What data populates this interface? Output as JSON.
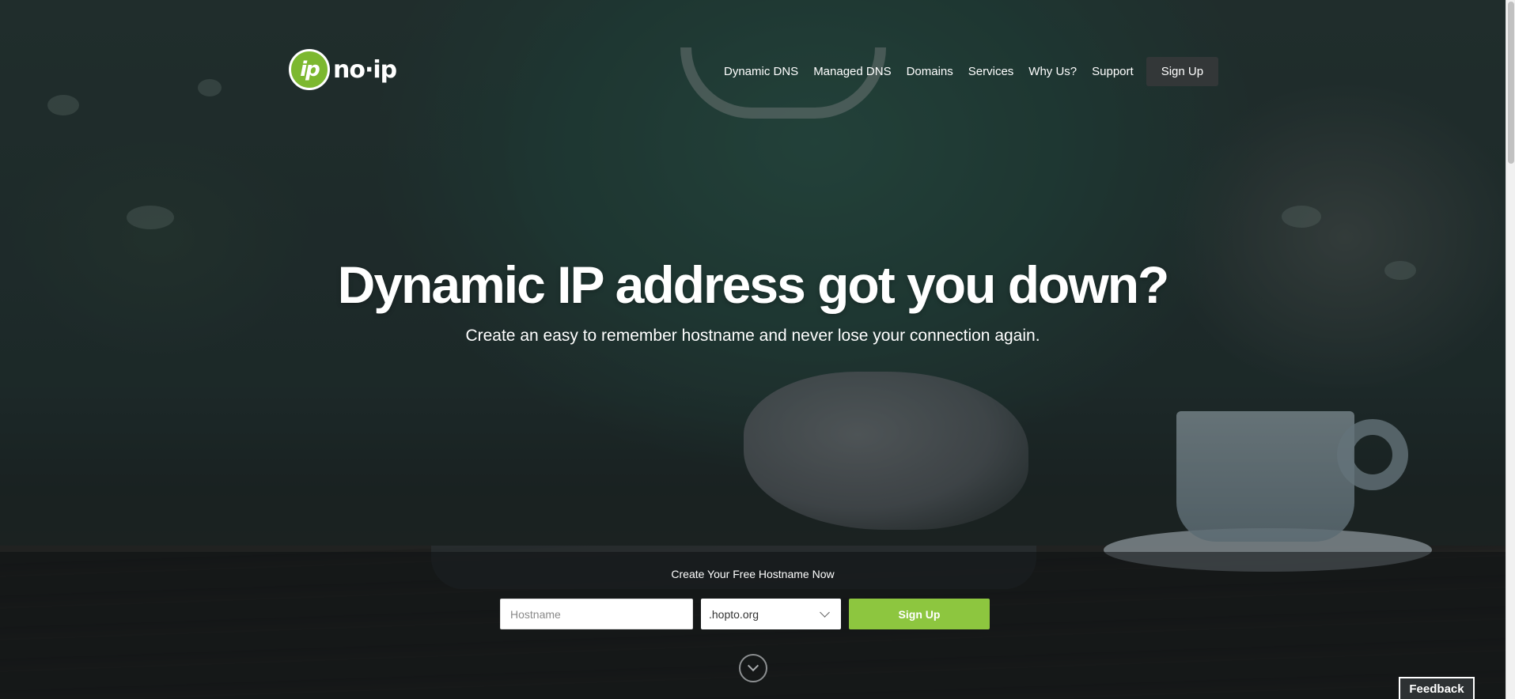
{
  "brand": {
    "logo_mark": "ip",
    "logo_text": "no·ip",
    "accent_color": "#8dc63f"
  },
  "nav": {
    "items": [
      "Dynamic DNS",
      "Managed DNS",
      "Domains",
      "Services",
      "Why Us?",
      "Support"
    ],
    "signup_label": "Sign Up"
  },
  "hero": {
    "headline": "Dynamic IP address got you down?",
    "subhead": "Create an easy to remember hostname and never lose your connection again."
  },
  "signup_form": {
    "title": "Create Your Free Hostname Now",
    "hostname_placeholder": "Hostname",
    "domain_selected": ".hopto.org",
    "submit_label": "Sign Up"
  },
  "scroll_icon": "chevron-down-icon",
  "feedback_label": "Feedback"
}
